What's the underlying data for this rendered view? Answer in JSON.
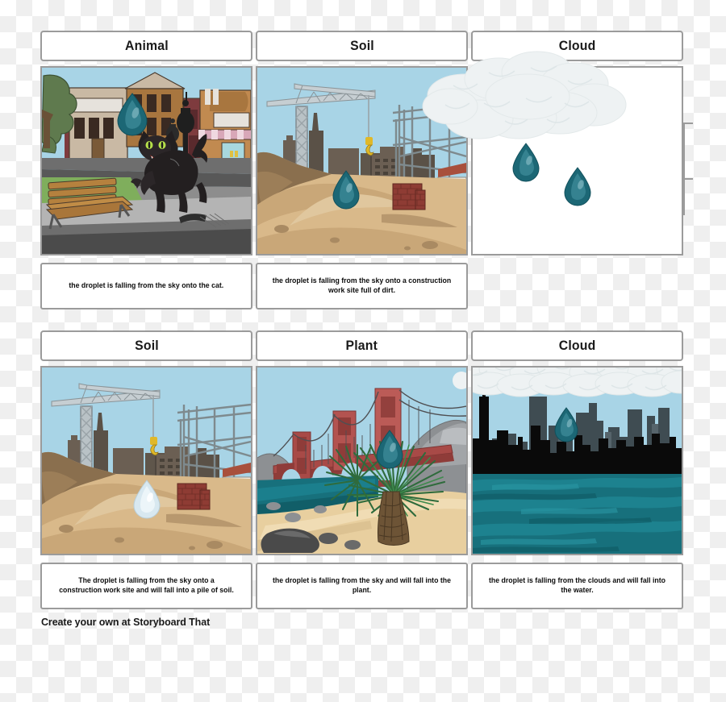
{
  "footer": {
    "text": "Create your own at Storyboard That"
  },
  "storyboard": {
    "rows": [
      {
        "cells": [
          {
            "title": "Animal",
            "scene": "city-street-black-cat",
            "caption": "the droplet is falling from the sky onto the cat.",
            "has_caption": true
          },
          {
            "title": "Soil",
            "scene": "construction-site-dirt",
            "caption": "the droplet is falling from the sky onto a construction work site full of dirt.",
            "has_caption": true
          },
          {
            "title": "Cloud",
            "scene": "white-sky-cloud-rain",
            "caption": "",
            "has_caption": false
          }
        ]
      },
      {
        "cells": [
          {
            "title": "Soil",
            "scene": "construction-site-dirt-light-drop",
            "caption": "The droplet is falling from the sky onto a construction work site and will fall into a pile of soil.",
            "has_caption": true
          },
          {
            "title": "Plant",
            "scene": "bridge-beach-palm",
            "caption": "the droplet is falling from the sky and will fall into the plant.",
            "has_caption": true
          },
          {
            "title": "Cloud",
            "scene": "city-skyline-water",
            "caption": "the droplet is falling from the clouds and will fall into the water.",
            "has_caption": true
          }
        ]
      }
    ]
  },
  "colors": {
    "droplet_teal": "#1c6775",
    "droplet_light": "#d8e8f0",
    "sky_blue": "#a8d4e6",
    "dirt_tan": "#d9b98a",
    "dirt_brown": "#8a6f4e",
    "cloud_white": "#eef2f3",
    "water_teal": "#17707c",
    "bridge_red": "#a84a47",
    "panel_border": "#9b9b9b",
    "plant_green": "#2f6b3c"
  }
}
